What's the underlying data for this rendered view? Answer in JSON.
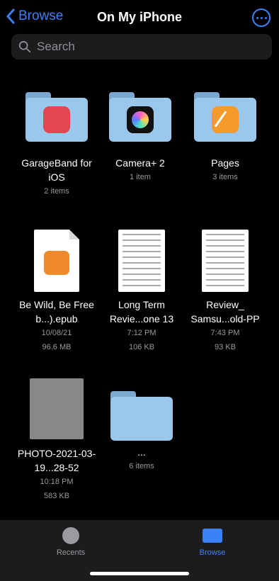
{
  "nav": {
    "back_label": "Browse",
    "title": "On My iPhone"
  },
  "search": {
    "placeholder": "Search"
  },
  "items": [
    {
      "name": "GarageBand for iOS",
      "meta1": "2 items",
      "meta2": ""
    },
    {
      "name": "Camera+ 2",
      "meta1": "1 item",
      "meta2": ""
    },
    {
      "name": "Pages",
      "meta1": "3 items",
      "meta2": ""
    },
    {
      "name": "Be Wild, Be Free b...).epub",
      "meta1": "10/08/21",
      "meta2": "96.6 MB"
    },
    {
      "name": "Long Term Revie...one 13",
      "meta1": "7:12 PM",
      "meta2": "106 KB"
    },
    {
      "name": "Review_ Samsu...old-PP",
      "meta1": "7:43 PM",
      "meta2": "93 KB"
    },
    {
      "name": "PHOTO-2021-03-19...28-52",
      "meta1": "10:18 PM",
      "meta2": "583 KB"
    },
    {
      "name": "...",
      "meta1": "6 items",
      "meta2": ""
    }
  ],
  "tabs": {
    "recents": "Recents",
    "browse": "Browse"
  },
  "colors": {
    "accent": "#3b82f6"
  }
}
